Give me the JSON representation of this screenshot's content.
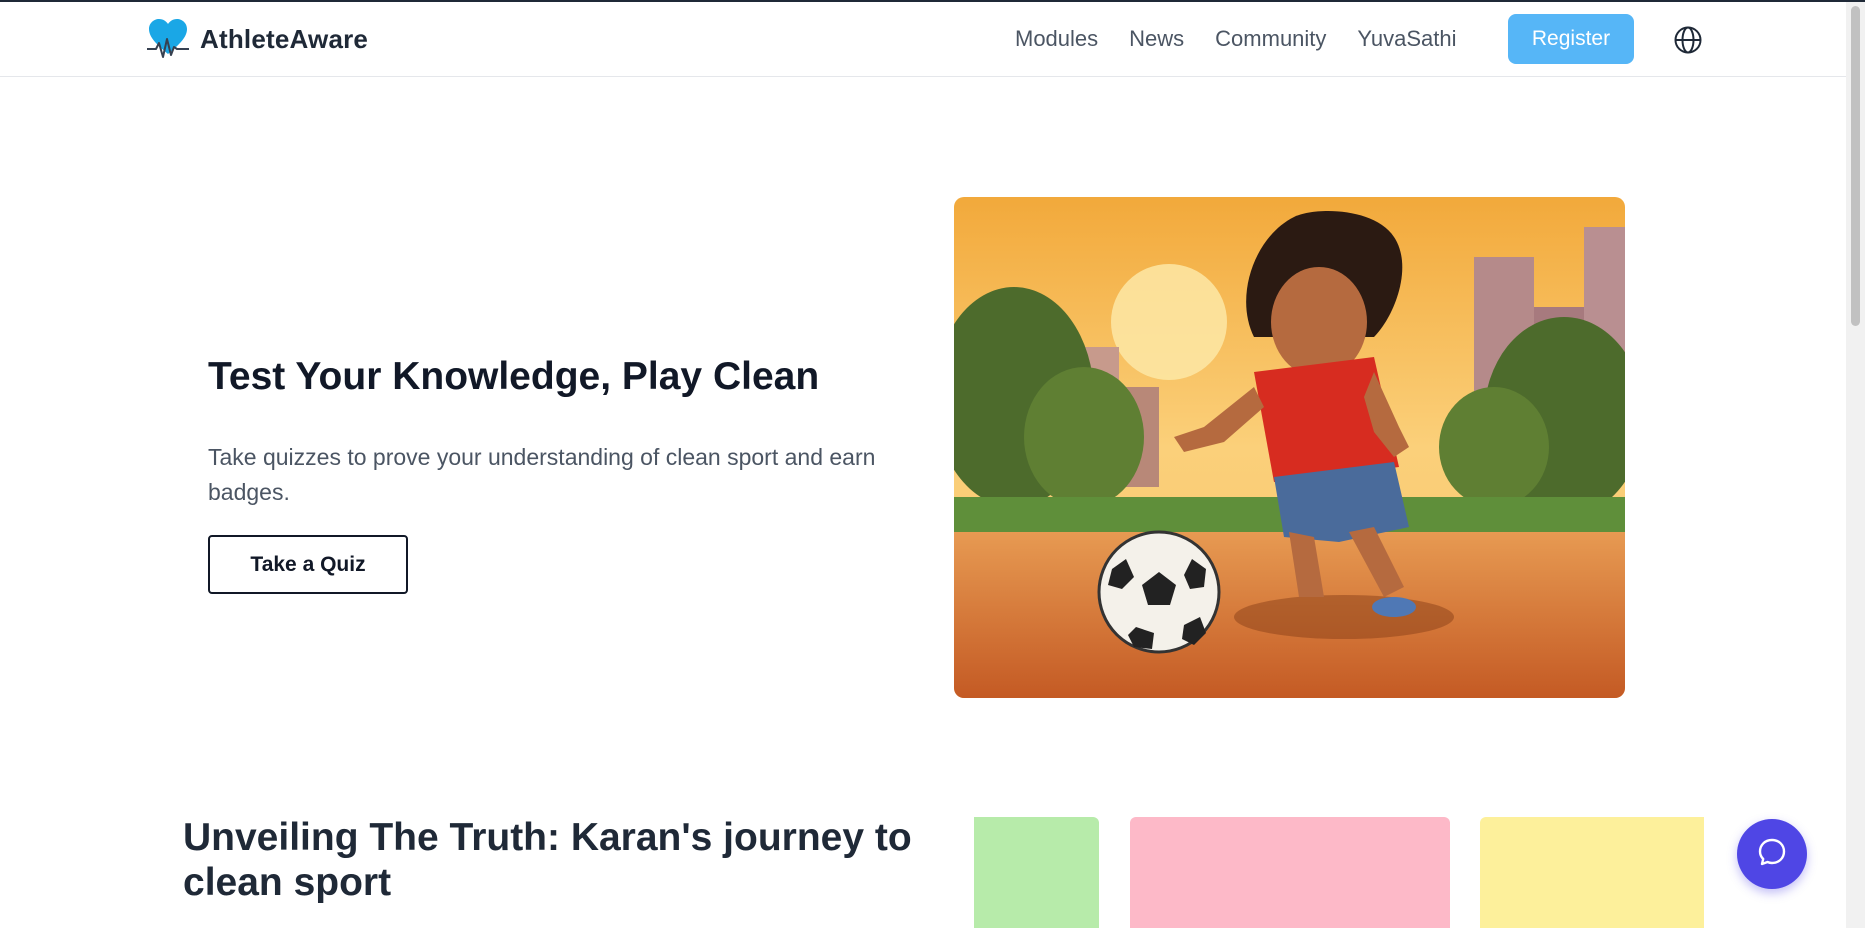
{
  "header": {
    "brand": "AthleteAware",
    "nav": [
      {
        "label": "Modules"
      },
      {
        "label": "News"
      },
      {
        "label": "Community"
      },
      {
        "label": "YuvaSathi"
      }
    ],
    "register_label": "Register",
    "language_icon": "globe-icon"
  },
  "hero": {
    "title": "Test Your Knowledge, Play Clean",
    "subtitle": "Take quizzes to prove your understanding of clean sport and earn badges.",
    "cta_label": "Take a Quiz",
    "image_icon": "cartoon-boy-playing-football-illustration"
  },
  "story": {
    "title": "Unveiling The Truth: Karan's journey to clean sport",
    "card_colors": [
      "#b7ebaa",
      "#fdb9c8",
      "#fdf09b"
    ]
  },
  "chat": {
    "icon": "chat-bubble-icon"
  },
  "colors": {
    "accent": "#56b6f7",
    "chat": "#4f46e5",
    "brand_heart": "#1aa7e6"
  }
}
